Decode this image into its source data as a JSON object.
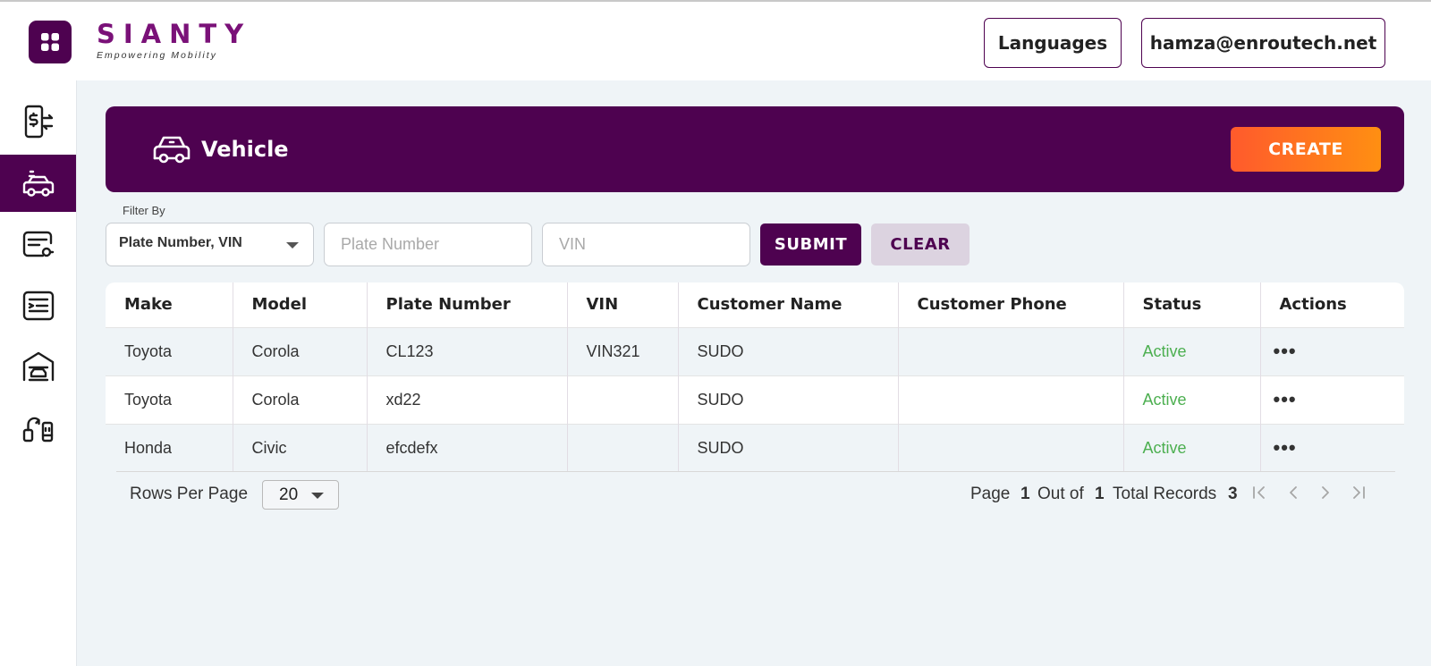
{
  "brand": {
    "name": "SIANTY",
    "tagline": "Empowering  Mobility",
    "color": "#4e0250"
  },
  "topbar": {
    "languages_label": "Languages",
    "user_email": "hamza@enroutech.net"
  },
  "sidebar": {
    "items": [
      {
        "icon": "billing-transfer-icon",
        "active": false
      },
      {
        "icon": "vehicle-icon",
        "active": true
      },
      {
        "icon": "rfid-card-icon",
        "active": false
      },
      {
        "icon": "form-list-icon",
        "active": false
      },
      {
        "icon": "garage-icon",
        "active": false
      },
      {
        "icon": "charger-connector-icon",
        "active": false
      }
    ]
  },
  "header": {
    "title": "Vehicle",
    "create_label": "CREATE"
  },
  "filter": {
    "label": "Filter By",
    "selected": "Plate Number, VIN",
    "plate_placeholder": "Plate Number",
    "vin_placeholder": "VIN",
    "submit_label": "SUBMIT",
    "clear_label": "CLEAR"
  },
  "table": {
    "columns": [
      "Make",
      "Model",
      "Plate Number",
      "VIN",
      "Customer Name",
      "Customer Phone",
      "Status",
      "Actions"
    ],
    "rows": [
      {
        "make": "Toyota",
        "model": "Corola",
        "plate": "CL123",
        "vin": "VIN321",
        "customer_name": "SUDO",
        "customer_phone": "",
        "status": "Active",
        "actions": "•••"
      },
      {
        "make": "Toyota",
        "model": "Corola",
        "plate": "xd22",
        "vin": "",
        "customer_name": "SUDO",
        "customer_phone": "",
        "status": "Active",
        "actions": "•••"
      },
      {
        "make": "Honda",
        "model": "Civic",
        "plate": "efcdefx",
        "vin": "",
        "customer_name": "SUDO",
        "customer_phone": "",
        "status": "Active",
        "actions": "•••"
      }
    ]
  },
  "pagination": {
    "rows_per_page_label": "Rows Per Page",
    "rows_per_page": "20",
    "page_label": "Page",
    "page": "1",
    "out_of_label": "Out of",
    "total_pages": "1",
    "total_records_label": "Total Records",
    "total_records": "3"
  },
  "colors": {
    "primary": "#4e0250",
    "accent_start": "#ff5a2c",
    "accent_end": "#ff8f12",
    "status_active": "#4caf50"
  }
}
